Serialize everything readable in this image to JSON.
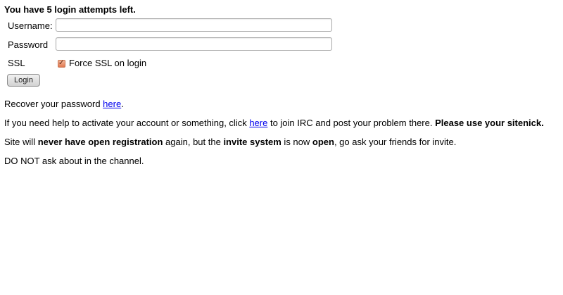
{
  "login": {
    "attempts_message": "You have 5 login attempts left.",
    "username_label": "Username:",
    "username_value": "",
    "password_label": "Password",
    "password_value": "",
    "ssl_label": "SSL",
    "ssl_checked": true,
    "ssl_checkbox_color": "#e07a52",
    "force_ssl_text": "Force SSL on login",
    "login_button_label": "Login"
  },
  "info": {
    "recover": {
      "before": "Recover your password ",
      "link": "here",
      "after": "."
    },
    "help": {
      "before": "If you need help to activate your account or something, click ",
      "link": "here",
      "middle": " to join IRC and post your problem there. ",
      "bold": "Please use your sitenick."
    },
    "registration": {
      "part1": "Site will ",
      "bold1": "never have open registration",
      "part2": " again, but the ",
      "bold2": "invite system",
      "part3": " is now ",
      "bold3": "open",
      "part4": ", go ask your friends for invite."
    },
    "donot": "DO NOT ask about in the channel."
  },
  "colors": {
    "link": "#0000ee",
    "text": "#000000",
    "background": "#ffffff"
  }
}
